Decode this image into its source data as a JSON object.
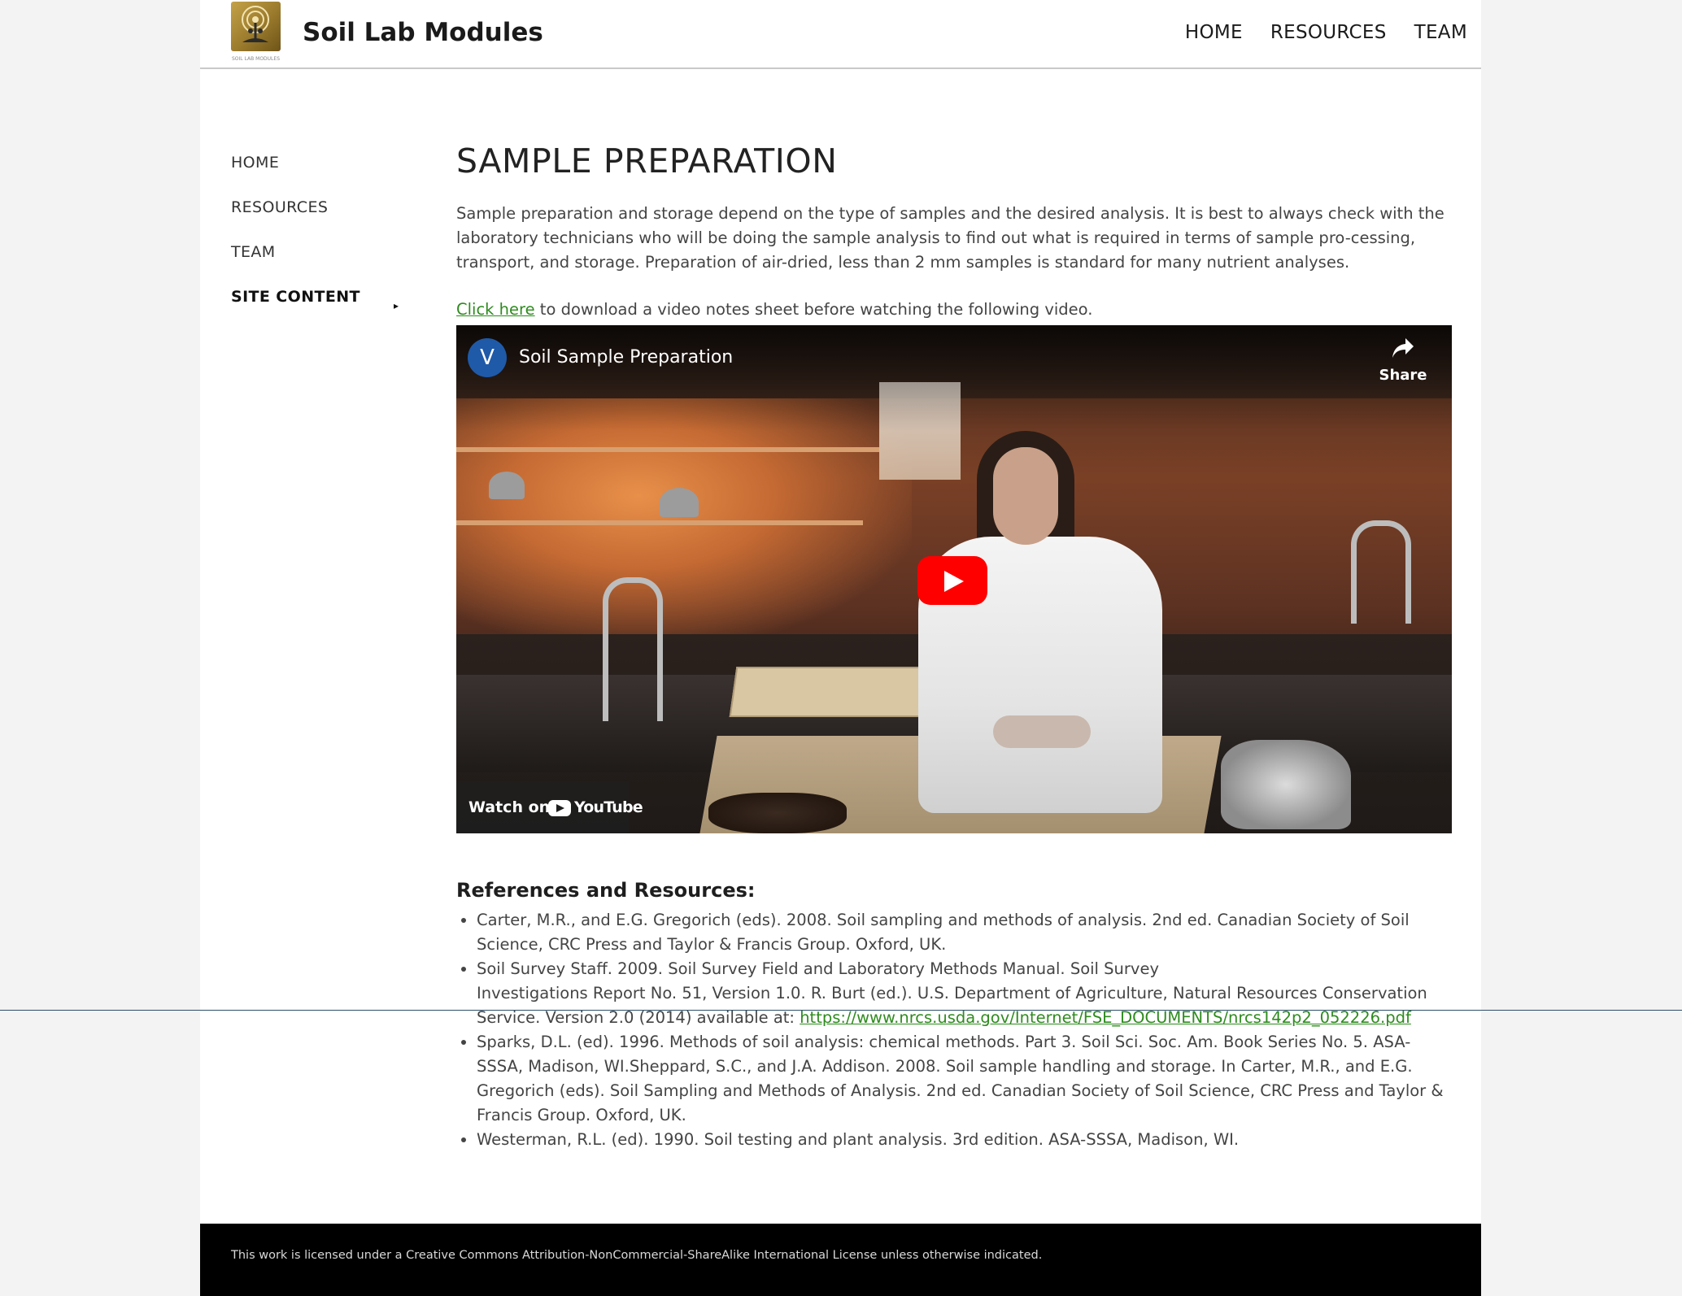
{
  "header": {
    "site_title": "Soil Lab Modules",
    "logo_caption": "SOIL LAB MODULES",
    "nav": [
      "HOME",
      "RESOURCES",
      "TEAM"
    ]
  },
  "sidebar": {
    "items": [
      {
        "label": "HOME"
      },
      {
        "label": "RESOURCES"
      },
      {
        "label": "TEAM"
      },
      {
        "label": "SITE CONTENT",
        "caret": "▸"
      }
    ]
  },
  "main": {
    "title": "SAMPLE PREPARATION",
    "intro": "Sample preparation and storage depend on the type of samples and the desired analysis.  It is best to always check with the laboratory technicians who will be doing the sample analysis to find out what is required in terms of sample pro-cessing, transport, and storage.  Preparation of air-dried, less than 2 mm samples is standard for many nutrient analyses.",
    "download_link": "Click here",
    "download_rest": " to download a video notes sheet before watching the following video."
  },
  "video": {
    "channel_initial": "V",
    "title": "Soil Sample Preparation",
    "share_label": "Share",
    "watch_on": "Watch on",
    "youtube_label": "YouTube"
  },
  "references": {
    "heading": "References and Resources:",
    "items": [
      {
        "text": "Carter, M.R., and E.G. Gregorich (eds). 2008. Soil sampling and methods of analysis. 2nd ed. Canadian Society of Soil Science, CRC Press and Taylor & Francis Group. Oxford, UK."
      },
      {
        "text": "Soil Survey Staff. 2009. Soil Survey Field and Laboratory Methods Manual. Soil Survey",
        "text2": "Investigations Report No. 51, Version 1.0. R. Burt (ed.). U.S. Department of Agriculture, Natural Resources Conservation Service. Version 2.0 (2014) available at: ",
        "link": "https://www.nrcs.usda.gov/Internet/FSE_DOCUMENTS/nrcs142p2_052226.pdf"
      },
      {
        "text": "Sparks, D.L. (ed). 1996.  Methods of soil analysis: chemical methods. Part 3. Soil Sci. Soc. Am. Book Series No. 5. ASA-SSSA, Madison, WI.Sheppard, S.C., and J.A. Addison. 2008. Soil sample handling and storage. In Carter, M.R., and E.G. Gregorich (eds). Soil Sampling and Methods of Analysis. 2nd ed. Canadian Society of Soil Science, CRC Press and Taylor & Francis Group. Oxford, UK."
      },
      {
        "text": "Westerman, R.L. (ed). 1990.  Soil testing and plant analysis. 3rd edition. ASA-SSSA, Madison, WI."
      }
    ]
  },
  "footer": {
    "text": "This work is licensed under a Creative Commons Attribution-NonCommercial-ShareAlike International License unless otherwise indicated."
  },
  "colors": {
    "link": "#2e8b1e",
    "footer_bg": "#000000",
    "play_button": "#ff0000",
    "avatar": "#1f5aa8"
  },
  "icons": [
    "site-logo",
    "caret-right-icon",
    "share-icon",
    "play-icon",
    "youtube-logo-icon"
  ]
}
